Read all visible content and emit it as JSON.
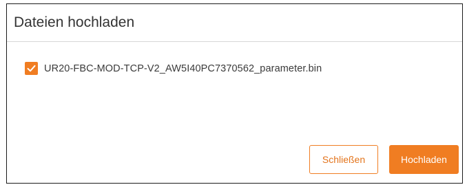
{
  "dialog": {
    "title": "Dateien hochladen"
  },
  "files": [
    {
      "name": "UR20-FBC-MOD-TCP-V2_AW5I40PC7370562_parameter.bin",
      "checked": true
    }
  ],
  "buttons": {
    "close_label": "Schließen",
    "upload_label": "Hochladen"
  },
  "colors": {
    "accent": "#f07d22",
    "title_text": "#333333",
    "border": "#1a1a1a"
  },
  "icons": {
    "checkbox": "checkmark-icon"
  }
}
